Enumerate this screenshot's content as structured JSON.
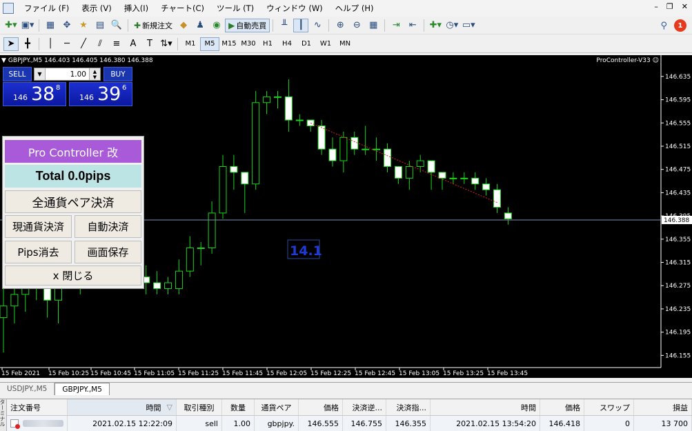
{
  "menu": {
    "items": [
      "ファイル (F)",
      "表示 (V)",
      "挿入(I)",
      "チャート(C)",
      "ツール (T)",
      "ウィンドウ (W)",
      "ヘルプ (H)"
    ]
  },
  "toolbar": {
    "new_order": "新規注文",
    "auto_trade": "自動売買",
    "notifications": "1",
    "timeframes": [
      "M1",
      "M5",
      "M15",
      "M30",
      "H1",
      "H4",
      "D1",
      "W1",
      "MN"
    ],
    "selected_timeframe": "M5"
  },
  "chart": {
    "symbol_header": "GBPJPY.,M5  146.403 146.405 146.380 146.388",
    "indicator_name": "ProController-V33",
    "current_price_label": "146.388",
    "pips_label": "14.1",
    "price_axis": [
      "146.635",
      "146.595",
      "146.555",
      "146.515",
      "146.475",
      "146.435",
      "146.395",
      "146.355",
      "146.315",
      "146.275",
      "146.235",
      "146.195",
      "146.155"
    ],
    "time_axis": [
      "15 Feb 2021",
      "15 Feb 10:25",
      "15 Feb 10:45",
      "15 Feb 11:05",
      "15 Feb 11:25",
      "15 Feb 11:45",
      "15 Feb 12:05",
      "15 Feb 12:25",
      "15 Feb 12:45",
      "15 Feb 13:05",
      "15 Feb 13:25",
      "15 Feb 13:45"
    ]
  },
  "chart_data": {
    "type": "candlestick",
    "ylim": [
      146.14,
      146.655
    ],
    "current_price": 146.388,
    "candles": [
      [
        146.22,
        146.24,
        146.3,
        146.16
      ],
      [
        146.24,
        146.26,
        146.28,
        146.21
      ],
      [
        146.26,
        146.3,
        146.31,
        146.23
      ],
      [
        146.3,
        146.28,
        146.32,
        146.25
      ],
      [
        146.28,
        146.25,
        146.31,
        146.22
      ],
      [
        146.25,
        146.29,
        146.3,
        146.21
      ],
      [
        146.29,
        146.31,
        146.33,
        146.27
      ],
      [
        146.31,
        146.3,
        146.32,
        146.26
      ],
      [
        146.3,
        146.32,
        146.34,
        146.27
      ],
      [
        146.32,
        146.31,
        146.34,
        146.28
      ],
      [
        146.31,
        146.3,
        146.33,
        146.28
      ],
      [
        146.3,
        146.31,
        146.33,
        146.29
      ],
      [
        146.31,
        146.29,
        146.32,
        146.27
      ],
      [
        146.29,
        146.28,
        146.31,
        146.26
      ],
      [
        146.28,
        146.27,
        146.3,
        146.26
      ],
      [
        146.27,
        146.28,
        146.29,
        146.26
      ],
      [
        146.27,
        146.3,
        146.32,
        146.26
      ],
      [
        146.3,
        146.34,
        146.36,
        146.29
      ],
      [
        146.34,
        146.34,
        146.35,
        146.31
      ],
      [
        146.34,
        146.4,
        146.42,
        146.33
      ],
      [
        146.4,
        146.48,
        146.5,
        146.39
      ],
      [
        146.48,
        146.47,
        146.5,
        146.44
      ],
      [
        146.47,
        146.45,
        146.47,
        146.4
      ],
      [
        146.45,
        146.59,
        146.61,
        146.44
      ],
      [
        146.59,
        146.6,
        146.61,
        146.57
      ],
      [
        146.6,
        146.6,
        146.61,
        146.58
      ],
      [
        146.6,
        146.56,
        146.63,
        146.54
      ],
      [
        146.56,
        146.56,
        146.57,
        146.55
      ],
      [
        146.56,
        146.55,
        146.56,
        146.54
      ],
      [
        146.55,
        146.51,
        146.56,
        146.5
      ],
      [
        146.51,
        146.49,
        146.53,
        146.48
      ],
      [
        146.49,
        146.53,
        146.54,
        146.47
      ],
      [
        146.53,
        146.51,
        146.54,
        146.5
      ],
      [
        146.51,
        146.51,
        146.55,
        146.5
      ],
      [
        146.51,
        146.51,
        146.53,
        146.49
      ],
      [
        146.51,
        146.48,
        146.52,
        146.47
      ],
      [
        146.48,
        146.46,
        146.48,
        146.45
      ],
      [
        146.46,
        146.48,
        146.49,
        146.44
      ],
      [
        146.48,
        146.49,
        146.5,
        146.47
      ],
      [
        146.49,
        146.47,
        146.49,
        146.44
      ],
      [
        146.47,
        146.46,
        146.47,
        146.44
      ],
      [
        146.46,
        146.46,
        146.47,
        146.45
      ],
      [
        146.46,
        146.46,
        146.47,
        146.45
      ],
      [
        146.46,
        146.45,
        146.47,
        146.44
      ],
      [
        146.45,
        146.44,
        146.46,
        146.43
      ],
      [
        146.44,
        146.41,
        146.45,
        146.4
      ],
      [
        146.4,
        146.39,
        146.41,
        146.38
      ]
    ]
  },
  "one_click": {
    "sell_label": "SELL",
    "buy_label": "BUY",
    "lot": "1.00",
    "sell_prefix": "146",
    "sell_big": "38",
    "sell_sup": "8",
    "buy_prefix": "146",
    "buy_big": "39",
    "buy_sup": "6"
  },
  "pro_controller": {
    "title": "Pro Controller 改",
    "total": "Total    0.0pips",
    "close_all": "全通貨ペア決済",
    "close_current": "現通貨決済",
    "auto_close": "自動決済",
    "erase_pips": "Pips消去",
    "save_screen": "画面保存",
    "close": "x 閉じる"
  },
  "tabs": [
    "USDJPY.,M5",
    "GBPJPY.,M5"
  ],
  "active_tab": 1,
  "terminal": {
    "side_label": "ターミナル",
    "columns": [
      "注文番号",
      "時間",
      "取引種別",
      "数量",
      "通貨ペア",
      "価格",
      "決済逆...",
      "決済指...",
      "時間",
      "価格",
      "スワップ",
      "損益"
    ],
    "row": [
      "",
      "2021.02.15 12:22:09",
      "sell",
      "1.00",
      "gbpjpy.",
      "146.555",
      "146.755",
      "146.355",
      "2021.02.15 13:54:20",
      "146.418",
      "0",
      "13 700"
    ]
  }
}
